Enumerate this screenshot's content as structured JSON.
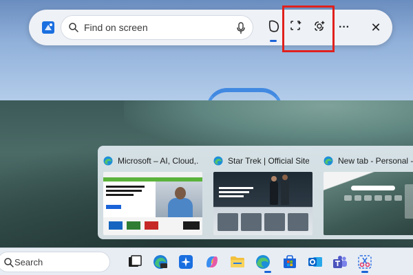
{
  "findbar": {
    "search_placeholder": "Find on screen",
    "icons": [
      "app-icon",
      "search-icon",
      "mic-icon",
      "visual-search-icon",
      "ai-region-icon",
      "ai-frame-icon",
      "more-icon",
      "close-icon"
    ],
    "more_label": "···",
    "close_label": "✕"
  },
  "previews": [
    {
      "title": "Microsoft – AI, Cloud,...",
      "icon": "edge-icon"
    },
    {
      "title": "Star Trek | Official Site...",
      "icon": "edge-icon"
    },
    {
      "title": "New tab - Personal - ...",
      "icon": "edge-icon"
    }
  ],
  "taskbar": {
    "search_label": "Search",
    "apps": [
      "task-view-icon",
      "edge-beta-icon",
      "snipping-sparkle-icon",
      "copilot-icon",
      "file-explorer-icon",
      "edge-icon",
      "store-icon",
      "outlook-icon",
      "teams-icon",
      "snipping-tool-icon"
    ]
  },
  "colors": {
    "highlight": "#e0201c",
    "accent": "#1a63d8"
  }
}
